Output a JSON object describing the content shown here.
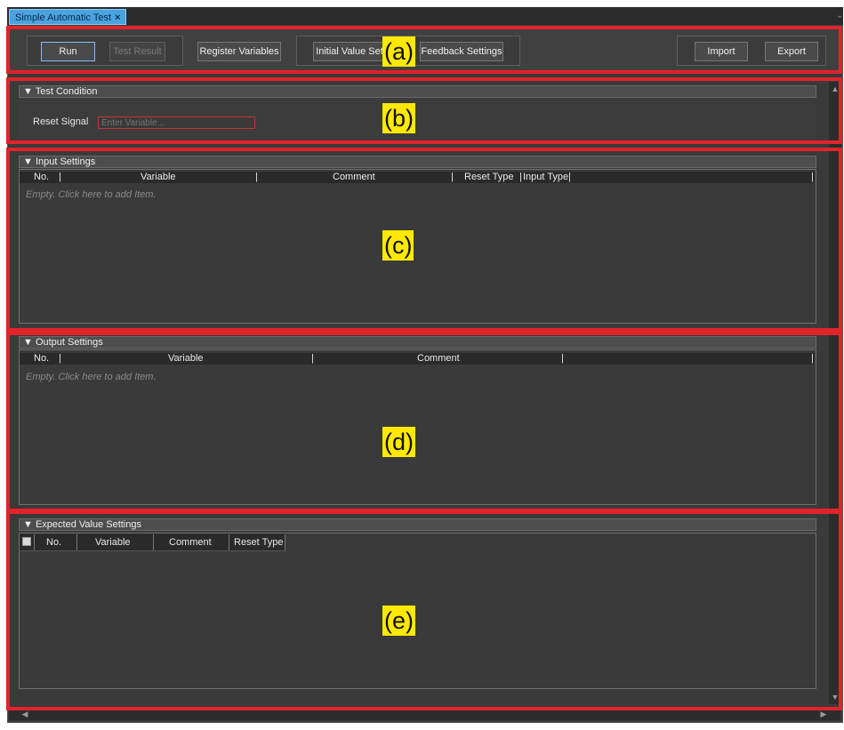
{
  "window": {
    "tab_title": "Simple Automatic Test",
    "tab_close": "×"
  },
  "toolbar": {
    "run": "Run",
    "test_result": "Test Result",
    "register_variables": "Register Variables",
    "initial_value_settings": "Initial Value Set",
    "feedback_settings": "Feedback Settings",
    "import": "Import",
    "export": "Export"
  },
  "test_condition": {
    "title": "▼ Test Condition",
    "reset_signal_label": "Reset Signal",
    "reset_signal_placeholder": "Enter Variable..."
  },
  "input_settings": {
    "title": "▼ Input Settings",
    "columns": [
      "No.",
      "Variable",
      "Comment",
      "Reset Type",
      "Input Type"
    ],
    "empty_text": "Empty. Click here to add Item."
  },
  "output_settings": {
    "title": "▼ Output Settings",
    "columns": [
      "No.",
      "Variable",
      "Comment"
    ],
    "empty_text": "Empty. Click here to add Item."
  },
  "expected_value_settings": {
    "title": "▼ Expected Value Settings",
    "columns": [
      "No.",
      "Variable",
      "Comment",
      "Reset Type"
    ]
  },
  "callouts": {
    "a": "(a)",
    "b": "(b)",
    "c": "(c)",
    "d": "(d)",
    "e": "(e)"
  },
  "colors": {
    "callout_border": "#e0242a",
    "callout_label_bg": "#ffe900",
    "tab_bg": "#4aa3df",
    "background": "#3a3a3a"
  }
}
